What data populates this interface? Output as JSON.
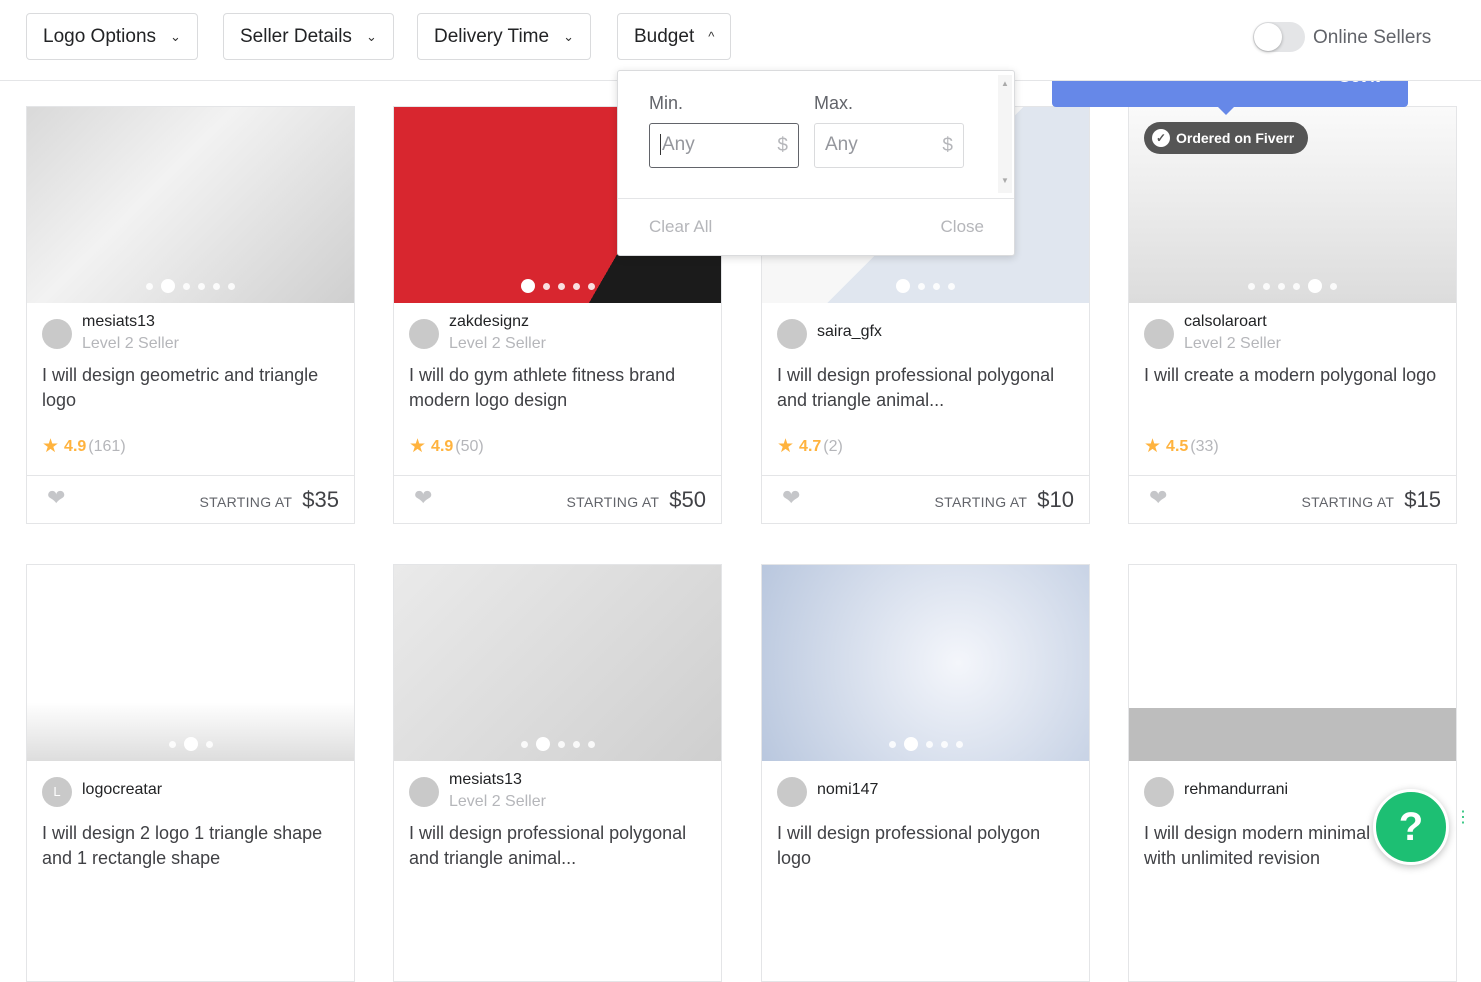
{
  "filters": [
    {
      "label": "Logo Options",
      "chevron": "chevron-down-icon"
    },
    {
      "label": "Seller Details",
      "chevron": "chevron-down-icon"
    },
    {
      "label": "Delivery Time",
      "chevron": "chevron-down-icon"
    },
    {
      "label": "Budget",
      "chevron": "chevron-up-icon"
    }
  ],
  "online_sellers": {
    "label": "Online Sellers",
    "on": false
  },
  "banner": {
    "label": "Got it",
    "color": "#6688e8"
  },
  "budget": {
    "min_label": "Min.",
    "max_label": "Max.",
    "min_placeholder": "Any",
    "max_placeholder": "Any",
    "currency": "$",
    "clear": "Clear All",
    "close": "Close"
  },
  "cards": [
    {
      "seller": "mesiats13",
      "level": "Level 2 Seller",
      "title": "I will design geometric and triangle logo",
      "rating": "4.9",
      "count": "(161)",
      "starting": "STARTING AT",
      "price": "$35",
      "dots": 6,
      "active": 1
    },
    {
      "seller": "zakdesignz",
      "level": "Level 2 Seller",
      "title": "I will do gym athlete fitness brand modern logo design",
      "rating": "4.9",
      "count": "(50)",
      "starting": "STARTING AT",
      "price": "$50",
      "dots": 5,
      "active": 0
    },
    {
      "seller": "saira_gfx",
      "level": "",
      "title": "I will design professional polygonal and triangle animal...",
      "rating": "4.7",
      "count": "(2)",
      "starting": "STARTING AT",
      "price": "$10",
      "dots": 4,
      "active": 0
    },
    {
      "seller": "calsolaroart",
      "level": "Level 2 Seller",
      "title": "I will create a modern polygonal logo",
      "rating": "4.5",
      "count": "(33)",
      "starting": "STARTING AT",
      "price": "$15",
      "dots": 6,
      "active": 4,
      "badge": "Ordered on Fiverr"
    },
    {
      "seller": "logocreatar",
      "level": "",
      "title": "I will design 2 logo 1 triangle shape and 1 rectangle shape",
      "avatar_letter": "L",
      "dots": 3,
      "active": 1
    },
    {
      "seller": "mesiats13",
      "level": "Level 2 Seller",
      "title": "I will design professional polygonal and triangle animal...",
      "dots": 5,
      "active": 1
    },
    {
      "seller": "nomi147",
      "level": "",
      "title": "I will design professional polygon logo",
      "dots": 5,
      "active": 1
    },
    {
      "seller": "rehmandurrani",
      "level": "",
      "title": "I will design modern minimal logo with unlimited revision",
      "dots": 0,
      "active": 0
    }
  ],
  "help": {
    "label": "?",
    "color": "#1dbf73"
  }
}
